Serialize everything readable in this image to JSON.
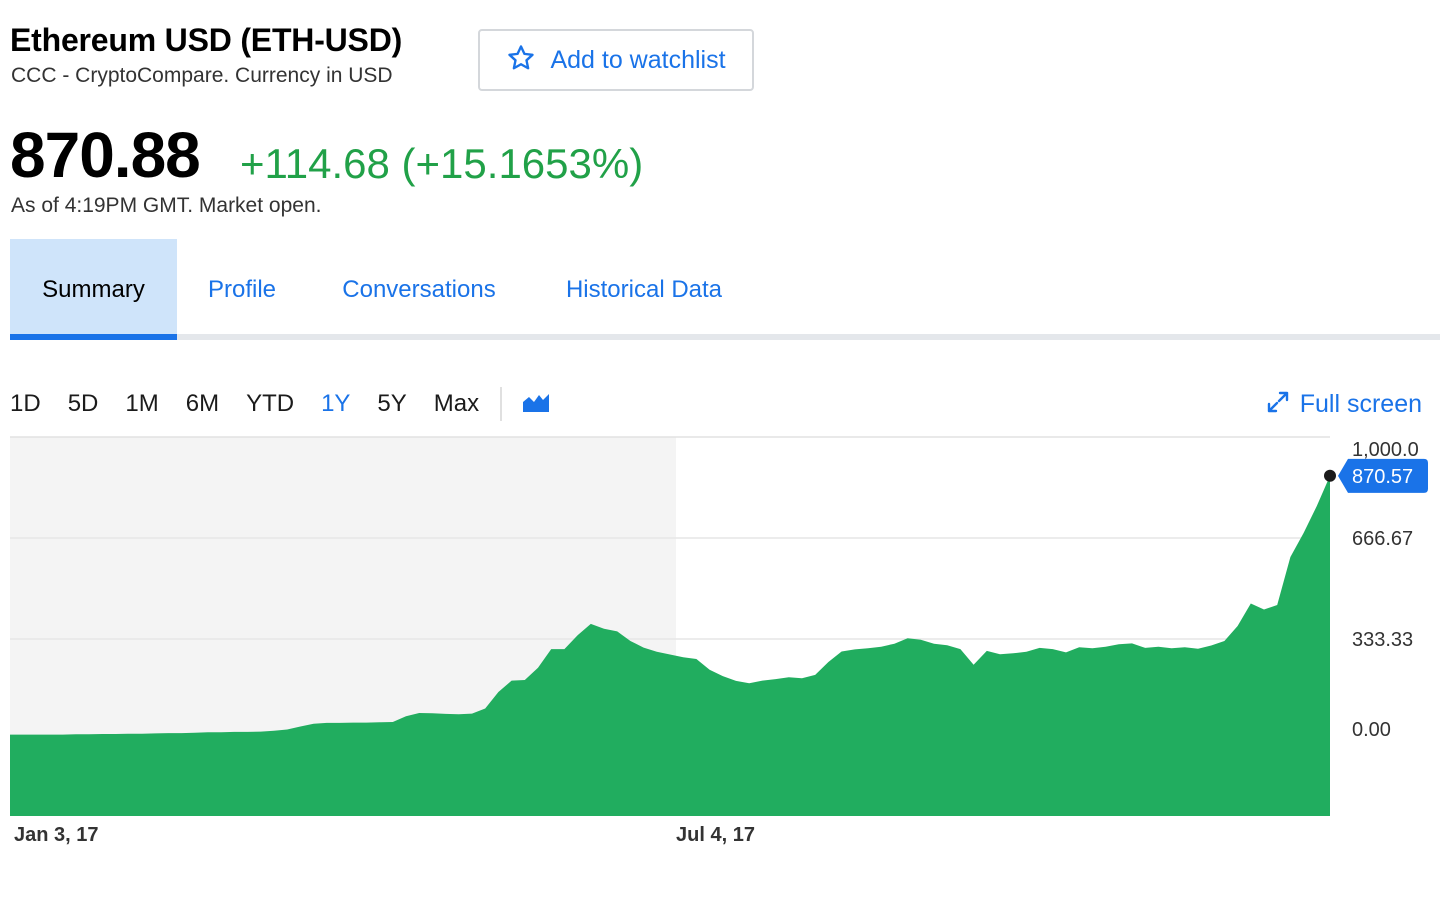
{
  "header": {
    "title": "Ethereum USD (ETH-USD)",
    "subtitle": "CCC - CryptoCompare. Currency in USD",
    "watchlist_label": "Add to watchlist"
  },
  "quote": {
    "price": "870.88",
    "change": "+114.68 (+15.1653%)",
    "as_of": "As of 4:19PM GMT. Market open."
  },
  "tabs": [
    {
      "label": "Summary",
      "active": true
    },
    {
      "label": "Profile"
    },
    {
      "label": "Conversations"
    },
    {
      "label": "Historical Data"
    }
  ],
  "ranges": [
    {
      "label": "1D"
    },
    {
      "label": "5D"
    },
    {
      "label": "1M"
    },
    {
      "label": "6M"
    },
    {
      "label": "YTD"
    },
    {
      "label": "1Y",
      "active": true
    },
    {
      "label": "5Y"
    },
    {
      "label": "Max"
    }
  ],
  "chart_type_icon": "mountain-chart-icon",
  "fullscreen_label": "Full screen",
  "colors": {
    "accent": "#1a73e8",
    "positive": "#21a148",
    "area_fill": "#21ad5f",
    "tab_active_bg": "#cfe4fa"
  },
  "chart_data": {
    "type": "area",
    "y_ticks": [
      "1,000.0",
      "666.67",
      "333.33",
      "0.00"
    ],
    "ylim": [
      0,
      1000
    ],
    "x_labels": [
      "Jan 3, 17",
      "Jul 4, 17"
    ],
    "current_label": "870.57",
    "current_value": 870.57,
    "grid": true,
    "series": [
      {
        "values": [
          8,
          8,
          8,
          8,
          8,
          9,
          9,
          10,
          10,
          11,
          11,
          12,
          13,
          13,
          14,
          16,
          16,
          17,
          17,
          18,
          21,
          25,
          35,
          44,
          47,
          47,
          48,
          48,
          49,
          50,
          69,
          80,
          79,
          77,
          76,
          78,
          95,
          150,
          188,
          190,
          231,
          293,
          293,
          339,
          377,
          361,
          352,
          320,
          298,
          284,
          275,
          266,
          260,
          224,
          203,
          187,
          179,
          188,
          193,
          199,
          196,
          207,
          250,
          285,
          292,
          296,
          301,
          311,
          329,
          324,
          311,
          306,
          293,
          241,
          287,
          276,
          279,
          284,
          297,
          293,
          282,
          299,
          296,
          301,
          309,
          312,
          297,
          301,
          296,
          299,
          294,
          305,
          320,
          370,
          445,
          425,
          440,
          600,
          680,
          770,
          870.57
        ]
      }
    ]
  }
}
